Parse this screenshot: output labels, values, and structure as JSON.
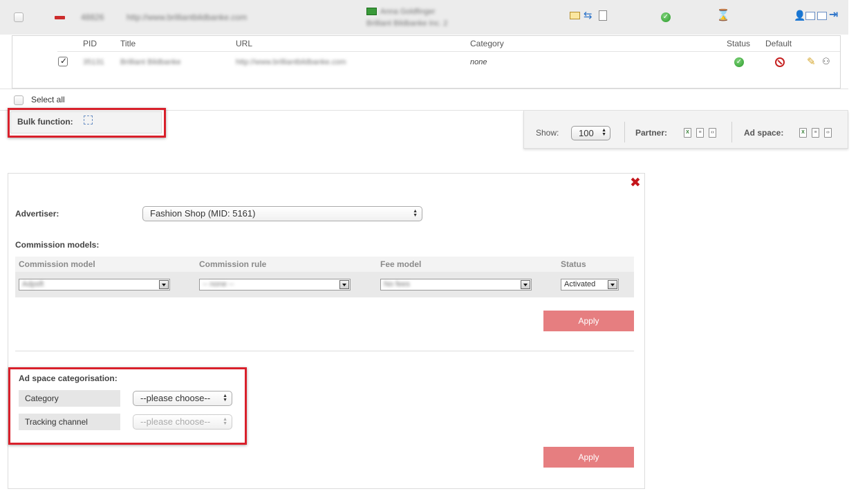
{
  "partner_row": {
    "id": "48826",
    "url": "http://www.brilliantbildbanke.com",
    "contact_name": "Anna Goldfinger",
    "contact_company": "Brilliant Bildbanke Inc. 2",
    "sub_table": {
      "headers": [
        "PID",
        "Title",
        "URL",
        "Category",
        "Status",
        "Default"
      ],
      "row": {
        "pid": "35131",
        "title": "Brilliant Bildbanke",
        "url": "http://www.brilliantbildbanke.com",
        "category": "none"
      }
    }
  },
  "select_all_label": "Select all",
  "bulk_function_label": "Bulk function:",
  "toolbar": {
    "show_label": "Show:",
    "show_value": "100",
    "partner_label": "Partner:",
    "ad_space_label": "Ad space:"
  },
  "dialog": {
    "advertiser_label": "Advertiser:",
    "advertiser_value": "Fashion Shop (MID: 5161)",
    "commission_models_label": "Commission models:",
    "cm_headers": [
      "Commission model",
      "Commission rule",
      "Fee model",
      "Status"
    ],
    "cm_values": {
      "model": "Adpsft",
      "rule": "-- none --",
      "fee": "No fees",
      "status": "Activated"
    },
    "apply_label": "Apply",
    "ad_space_cat_label": "Ad space categorisation:",
    "category_label": "Category",
    "category_value": "--please choose--",
    "tracking_label": "Tracking channel",
    "tracking_value": "--please choose--",
    "apply2_label": "Apply"
  },
  "colors": {
    "highlight_red": "#d9202b",
    "apply_button": "#e67e80",
    "ok_green": "#2a9a2a"
  }
}
